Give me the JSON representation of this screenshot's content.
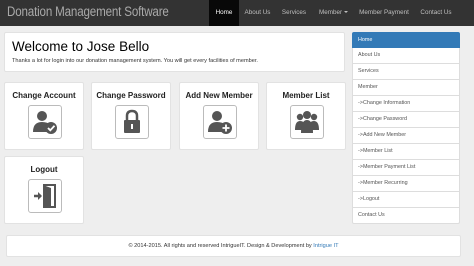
{
  "navbar": {
    "brand": "Donation Management Software",
    "items": [
      {
        "label": "Home",
        "active": true
      },
      {
        "label": "About Us"
      },
      {
        "label": "Services"
      },
      {
        "label": "Member"
      },
      {
        "label": "Member Payment"
      },
      {
        "label": "Contact Us"
      }
    ]
  },
  "welcome": {
    "greeting": "Welcome to",
    "user": "Jose Bello",
    "message": "Thanks a lot for login into our donation management system. You will get every facilities of member."
  },
  "cards": [
    {
      "title": "Change Account",
      "icon": "user-check-icon"
    },
    {
      "title": "Change Password",
      "icon": "lock-icon"
    },
    {
      "title": "Add New Member",
      "icon": "user-add-icon"
    },
    {
      "title": "Member List",
      "icon": "users-group-icon"
    },
    {
      "title": "Logout",
      "icon": "exit-door-icon"
    }
  ],
  "sidebar": {
    "items": [
      {
        "label": "Home",
        "active": true
      },
      {
        "label": "About Us"
      },
      {
        "label": "Services"
      },
      {
        "label": "Member"
      },
      {
        "label": "->Change Information"
      },
      {
        "label": "->Change Password"
      },
      {
        "label": "->Add New Member"
      },
      {
        "label": "->Member List"
      },
      {
        "label": "->Member Payment List"
      },
      {
        "label": "->Member Recurring"
      },
      {
        "label": "->Logout"
      },
      {
        "label": "Contact Us"
      }
    ]
  },
  "footer": {
    "text": "© 2014-2015. All rights and reserved IntrigueIT. Design & Development by",
    "link": "Intrigue IT"
  },
  "colors": {
    "navbar_bg": "#333333",
    "active_nav_bg": "#080808",
    "accent": "#337ab7",
    "icon_gray": "#555555"
  }
}
